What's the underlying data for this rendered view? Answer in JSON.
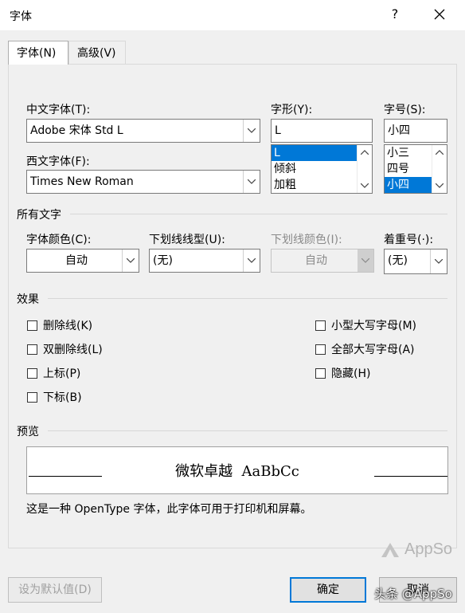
{
  "window": {
    "title": "字体",
    "help": "?",
    "close": "×"
  },
  "tabs": [
    {
      "label": "字体(N)"
    },
    {
      "label": "高级(V)"
    }
  ],
  "chinese_font": {
    "label": "中文字体(T):",
    "value": "Adobe 宋体 Std L"
  },
  "western_font": {
    "label": "西文字体(F):",
    "value": "Times New Roman"
  },
  "style": {
    "label": "字形(Y):",
    "value": "L",
    "options": [
      "L",
      "倾斜",
      "加粗"
    ]
  },
  "size": {
    "label": "字号(S):",
    "value": "小四",
    "options": [
      "小三",
      "四号",
      "小四"
    ]
  },
  "all_text": {
    "heading": "所有文字",
    "font_color": {
      "label": "字体颜色(C):",
      "value": "自动"
    },
    "underline_style": {
      "label": "下划线线型(U):",
      "value": "(无)"
    },
    "underline_color": {
      "label": "下划线颜色(I):",
      "value": "自动"
    },
    "emphasis": {
      "label": "着重号(·):",
      "value": "(无)"
    }
  },
  "effects": {
    "heading": "效果",
    "left": [
      "删除线(K)",
      "双删除线(L)",
      "上标(P)",
      "下标(B)"
    ],
    "right": [
      "小型大写字母(M)",
      "全部大写字母(A)",
      "隐藏(H)"
    ]
  },
  "preview": {
    "heading": "预览",
    "sample": "微软卓越  AaBbCc",
    "note": "这是一种 OpenType 字体，此字体可用于打印机和屏幕。"
  },
  "watermark": {
    "brand": "AppSo",
    "credit": "头条 @AppSo"
  },
  "buttons": {
    "set_default": "设为默认值(D)",
    "ok": "确定",
    "cancel": "取消"
  }
}
